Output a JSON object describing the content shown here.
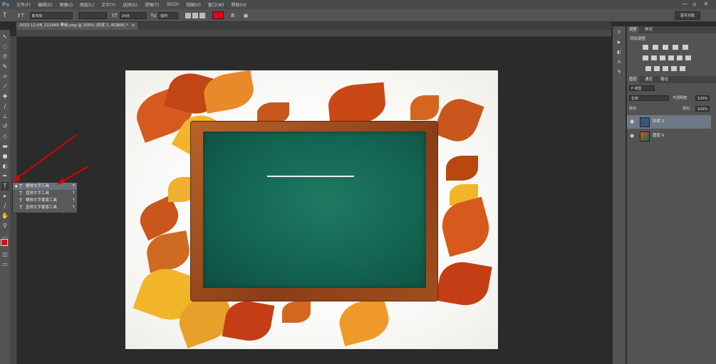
{
  "app": {
    "logo": "Ps"
  },
  "menu": [
    "文件(F)",
    "编辑(E)",
    "图像(I)",
    "图层(L)",
    "文字(Y)",
    "选择(S)",
    "滤镜(T)",
    "3D(D)",
    "视图(V)",
    "窗口(W)",
    "帮助(H)"
  ],
  "window_controls": [
    "—",
    "▫",
    "✕"
  ],
  "options": {
    "tool_icon": "T",
    "orient_icon": "↕T",
    "font_family": "新宋体",
    "font_style": "",
    "size_icon": "tT",
    "font_size": "24点",
    "aa_icon": "ªa",
    "aa_mode": "锐利",
    "align_icons": [
      "left-align-icon",
      "center-align-icon",
      "right-align-icon"
    ],
    "text_color": "#e8001c",
    "warp_icon": "warp-text-icon",
    "panel_icon": "character-panel-icon",
    "workspace": "基本功能"
  },
  "document": {
    "tab_title": "2022-12-08_111449 黑板.png @ 100% (形状 1, RGB/8) *",
    "close": "×"
  },
  "tools_panel": {
    "flyout": [
      {
        "label": "横排文字工具",
        "key": "T",
        "selected": true
      },
      {
        "label": "直排文字工具",
        "key": "T",
        "selected": false
      },
      {
        "label": "横排文字蒙版工具",
        "key": "T",
        "selected": false
      },
      {
        "label": "直排文字蒙版工具",
        "key": "T",
        "selected": false
      }
    ],
    "foreground_color": "#e8001c",
    "background_color": "#ffffff"
  },
  "panels": {
    "top_tabs": [
      "调整",
      "样式"
    ],
    "adjust_title": "添加调整",
    "layer_tabs": [
      "图层",
      "通道",
      "路径"
    ],
    "kind_filter": "P 类型",
    "blend_mode": "正常",
    "opacity_label": "不透明度:",
    "opacity": "100%",
    "lock_label": "锁定:",
    "fill_label": "填充:",
    "fill": "100%",
    "layers": [
      {
        "name": "形状 1",
        "selected": true
      },
      {
        "name": "图层 0",
        "selected": false
      }
    ]
  }
}
